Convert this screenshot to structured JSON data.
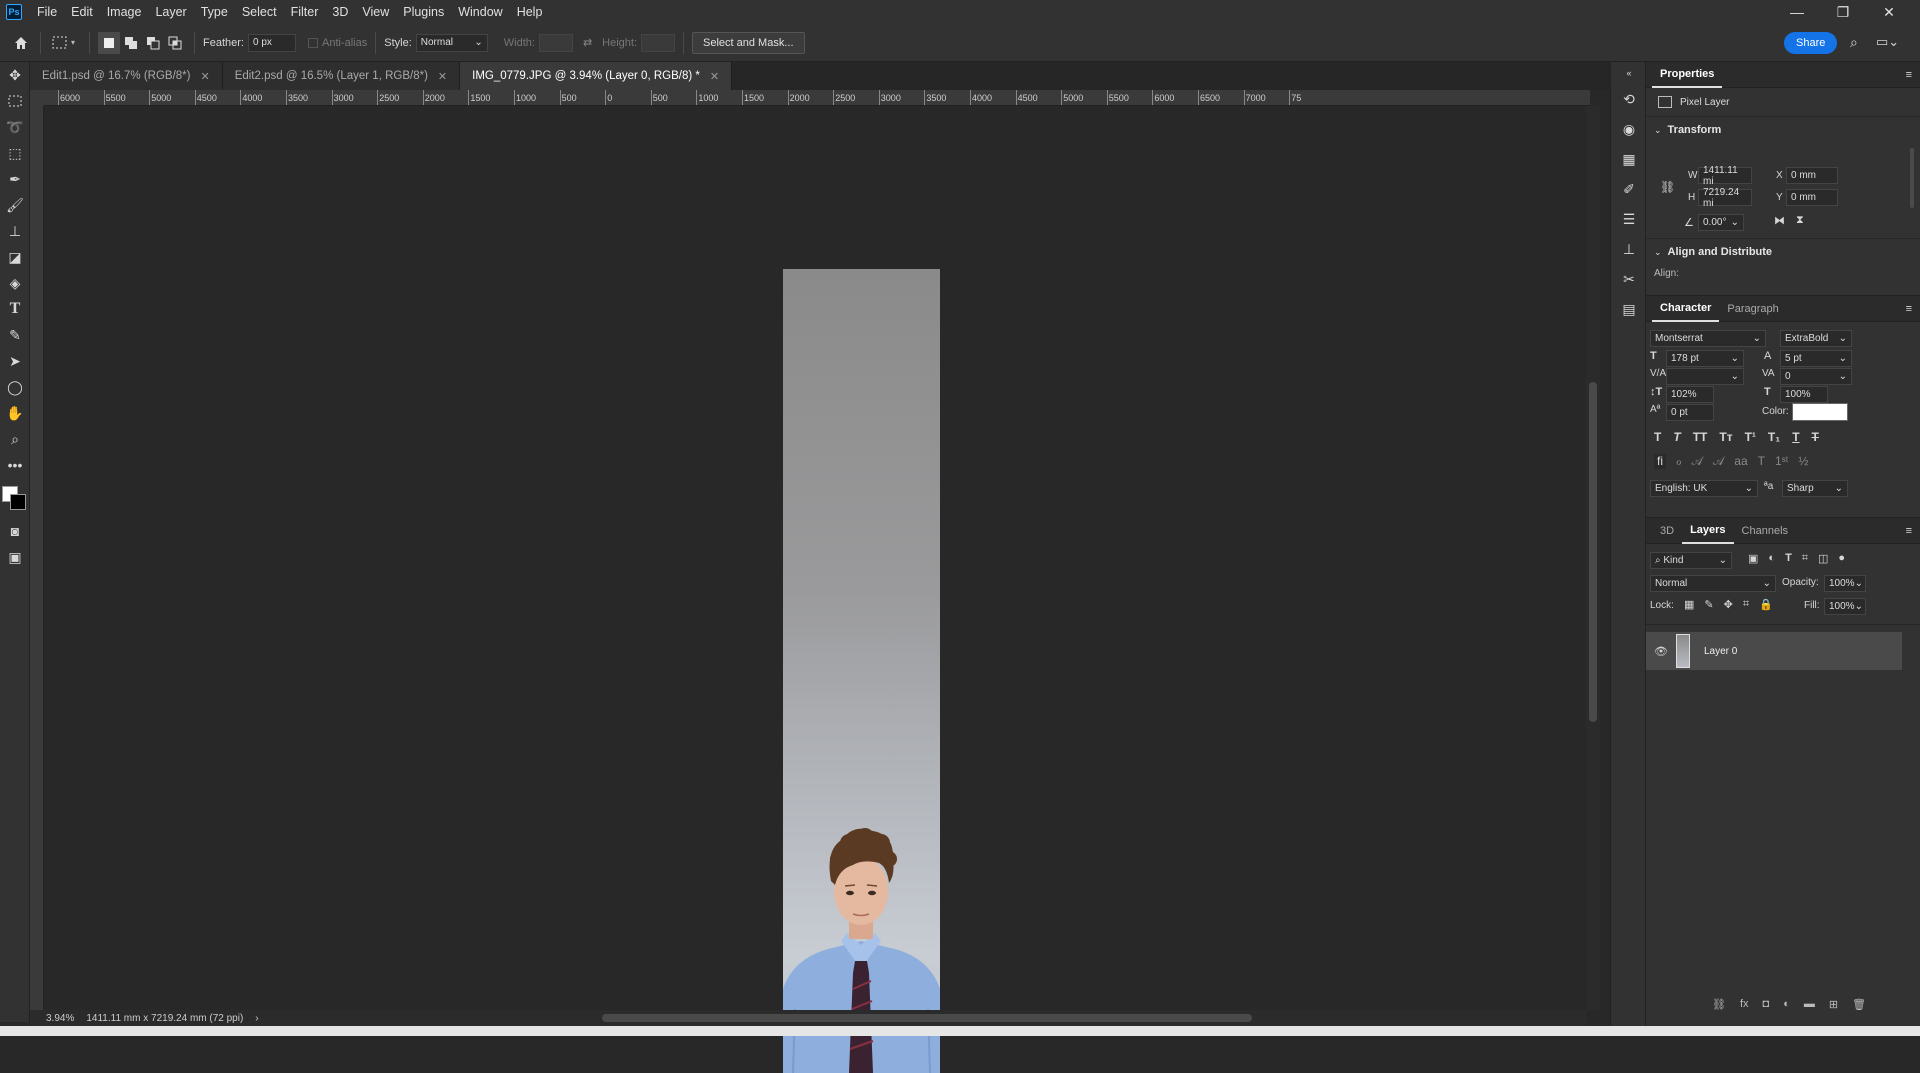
{
  "app": {
    "logo": "Ps"
  },
  "menu": [
    "File",
    "Edit",
    "Image",
    "Layer",
    "Type",
    "Select",
    "Filter",
    "3D",
    "View",
    "Plugins",
    "Window",
    "Help"
  ],
  "window_controls": {
    "minimize": "—",
    "restore": "❐",
    "close": "✕"
  },
  "options": {
    "feather_label": "Feather:",
    "feather_value": "0 px",
    "antialias_label": "Anti-alias",
    "style_label": "Style:",
    "style_value": "Normal",
    "width_label": "Width:",
    "height_label": "Height:",
    "select_mask": "Select and Mask...",
    "share": "Share"
  },
  "tabs": [
    {
      "label": "Edit1.psd @ 16.7% (RGB/8*)"
    },
    {
      "label": "Edit2.psd @ 16.5% (Layer 1, RGB/8*)"
    },
    {
      "label": "IMG_0779.JPG @ 3.94% (Layer 0, RGB/8) *"
    }
  ],
  "ruler_labels": [
    "6000",
    "5500",
    "5000",
    "4500",
    "4000",
    "3500",
    "3000",
    "2500",
    "2000",
    "1500",
    "1000",
    "500",
    "0",
    "500",
    "1000",
    "1500",
    "2000",
    "2500",
    "3000",
    "3500",
    "4000",
    "4500",
    "5000",
    "5500",
    "6000",
    "6500",
    "7000",
    "75"
  ],
  "status": {
    "zoom": "3.94%",
    "doc_size": "1411.11 mm x 7219.24 mm (72 ppi)"
  },
  "properties": {
    "title": "Properties",
    "layer_type": "Pixel Layer",
    "transform_title": "Transform",
    "w_label": "W",
    "w_value": "1411.11 mi",
    "h_label": "H",
    "h_value": "7219.24 mi",
    "x_label": "X",
    "x_value": "0 mm",
    "y_label": "Y",
    "y_value": "0 mm",
    "angle_value": "0.00°",
    "align_title": "Align and Distribute",
    "align_label": "Align:"
  },
  "character": {
    "tabs": [
      "Character",
      "Paragraph"
    ],
    "font_family": "Montserrat",
    "font_style": "ExtraBold",
    "size": "178 pt",
    "leading": "5 pt",
    "kerning": "",
    "tracking": "0",
    "vscale": "102%",
    "hscale": "100%",
    "baseline": "0 pt",
    "color_label": "Color:",
    "language": "English: UK",
    "antialias": "Sharp",
    "color_swatch": "#ffffff"
  },
  "layers": {
    "tabs": [
      "3D",
      "Layers",
      "Channels"
    ],
    "kind": "Kind",
    "blend": "Normal",
    "opacity_label": "Opacity:",
    "opacity": "100%",
    "lock_label": "Lock:",
    "fill_label": "Fill:",
    "fill": "100%",
    "layer_name": "Layer 0"
  }
}
